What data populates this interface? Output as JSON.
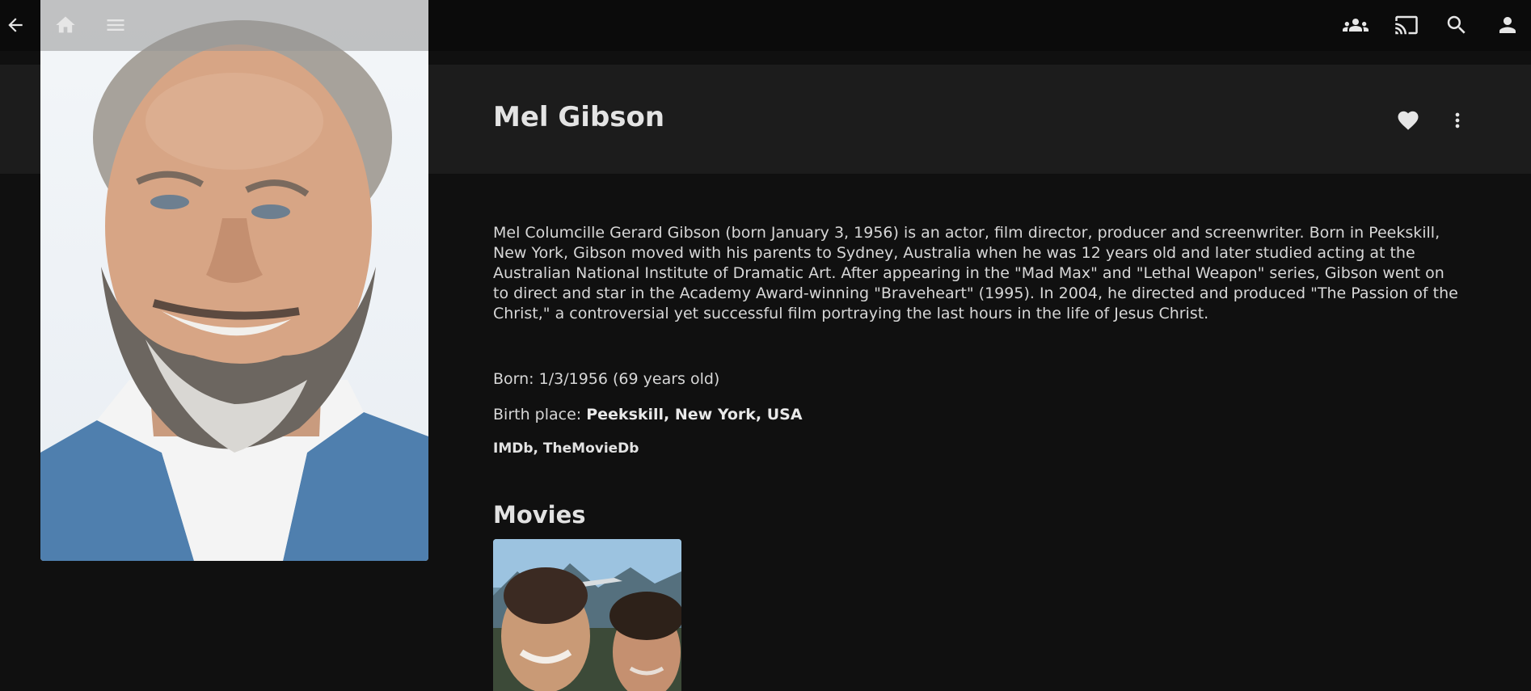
{
  "topbar": {
    "icons": {
      "back": "back-arrow-icon",
      "home": "home-icon",
      "menu": "menu-icon",
      "users": "users-icon",
      "cast": "cast-icon",
      "search": "search-icon",
      "user": "user-icon"
    }
  },
  "person": {
    "name": "Mel Gibson",
    "bio": "Mel Columcille Gerard Gibson (born January 3, 1956) is an actor, film director, producer and screenwriter. Born in Peekskill, New York, Gibson moved with his parents to Sydney, Australia when he was 12 years old and later studied acting at the Australian National Institute of Dramatic Art. After appearing in the \"Mad Max\" and \"Lethal Weapon\" series, Gibson went on to direct and star in the Academy Award-winning \"Braveheart\" (1995). In 2004, he directed and produced \"The Passion of the Christ,\" a controversial yet successful film portraying the last hours in the life of Jesus Christ.",
    "born_label": "Born:",
    "born_value": "1/3/1956 (69 years old)",
    "birthplace_label": "Birth place:",
    "birthplace_value": "Peekskill, New York, USA",
    "links": [
      "IMDb",
      "TheMovieDb"
    ],
    "links_separator": ", "
  },
  "sections": {
    "movies_heading": "Movies"
  },
  "colors": {
    "background": "#101010",
    "header_band": "#1c1c1c",
    "topbar": "#0b0b0b"
  }
}
